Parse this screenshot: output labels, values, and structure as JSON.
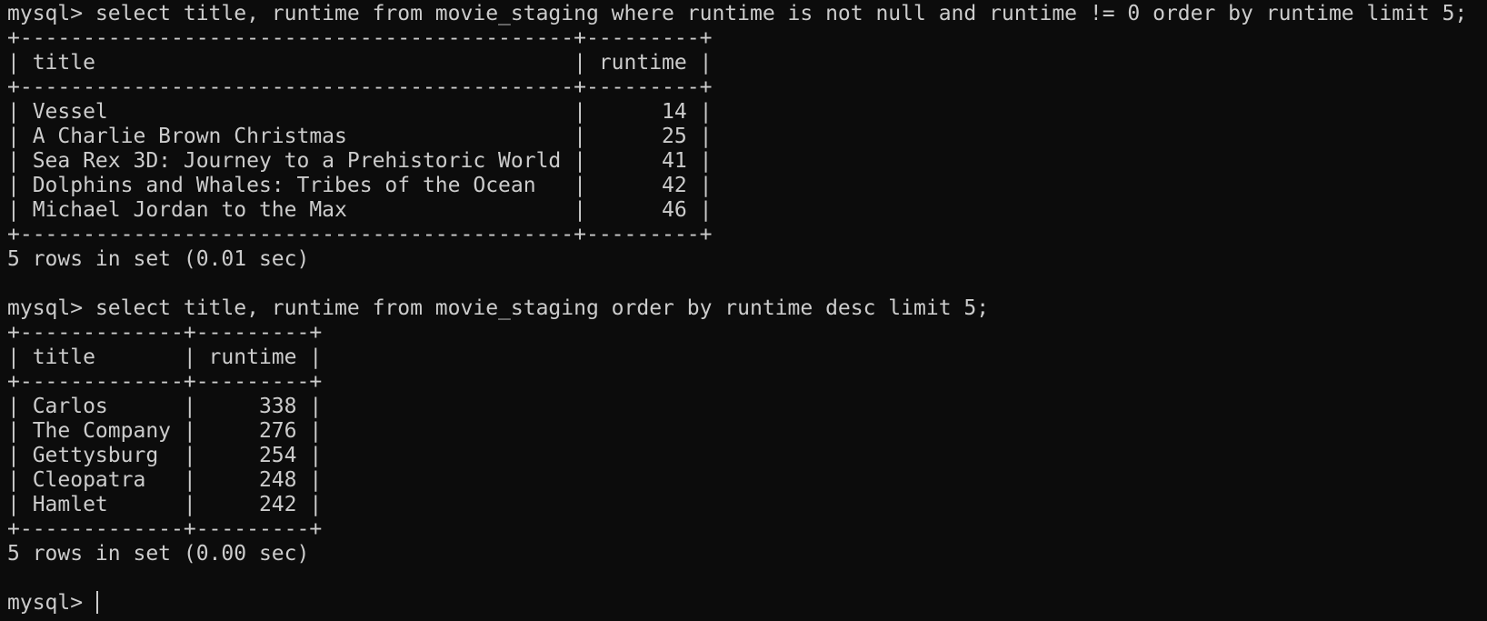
{
  "terminal": {
    "lines": [
      {
        "kind": "prompt",
        "prompt": "mysql> ",
        "command": "select title, runtime from movie_staging where runtime is not null and runtime != 0 order by runtime limit 5;"
      },
      {
        "kind": "border",
        "text": "+--------------------------------------------+---------+"
      },
      {
        "kind": "header",
        "text": "| title                                      | runtime |"
      },
      {
        "kind": "border",
        "text": "+--------------------------------------------+---------+"
      },
      {
        "kind": "row",
        "text": "| Vessel                                     |      14 |"
      },
      {
        "kind": "row",
        "text": "| A Charlie Brown Christmas                  |      25 |"
      },
      {
        "kind": "row",
        "text": "| Sea Rex 3D: Journey to a Prehistoric World |      41 |"
      },
      {
        "kind": "row",
        "text": "| Dolphins and Whales: Tribes of the Ocean   |      42 |"
      },
      {
        "kind": "row",
        "text": "| Michael Jordan to the Max                  |      46 |"
      },
      {
        "kind": "border",
        "text": "+--------------------------------------------+---------+"
      },
      {
        "kind": "status",
        "text": "5 rows in set (0.01 sec)"
      },
      {
        "kind": "blank",
        "text": ""
      },
      {
        "kind": "prompt",
        "prompt": "mysql> ",
        "command": "select title, runtime from movie_staging order by runtime desc limit 5;"
      },
      {
        "kind": "border",
        "text": "+-------------+---------+"
      },
      {
        "kind": "header",
        "text": "| title       | runtime |"
      },
      {
        "kind": "border",
        "text": "+-------------+---------+"
      },
      {
        "kind": "row",
        "text": "| Carlos      |     338 |"
      },
      {
        "kind": "row",
        "text": "| The Company |     276 |"
      },
      {
        "kind": "row",
        "text": "| Gettysburg  |     254 |"
      },
      {
        "kind": "row",
        "text": "| Cleopatra   |     248 |"
      },
      {
        "kind": "row",
        "text": "| Hamlet      |     242 |"
      },
      {
        "kind": "border",
        "text": "+-------------+---------+"
      },
      {
        "kind": "status",
        "text": "5 rows in set (0.00 sec)"
      },
      {
        "kind": "blank",
        "text": ""
      },
      {
        "kind": "input",
        "prompt": "mysql> ",
        "command": ""
      }
    ]
  },
  "colors": {
    "background": "#0c0c0c",
    "foreground": "#cccccc"
  }
}
